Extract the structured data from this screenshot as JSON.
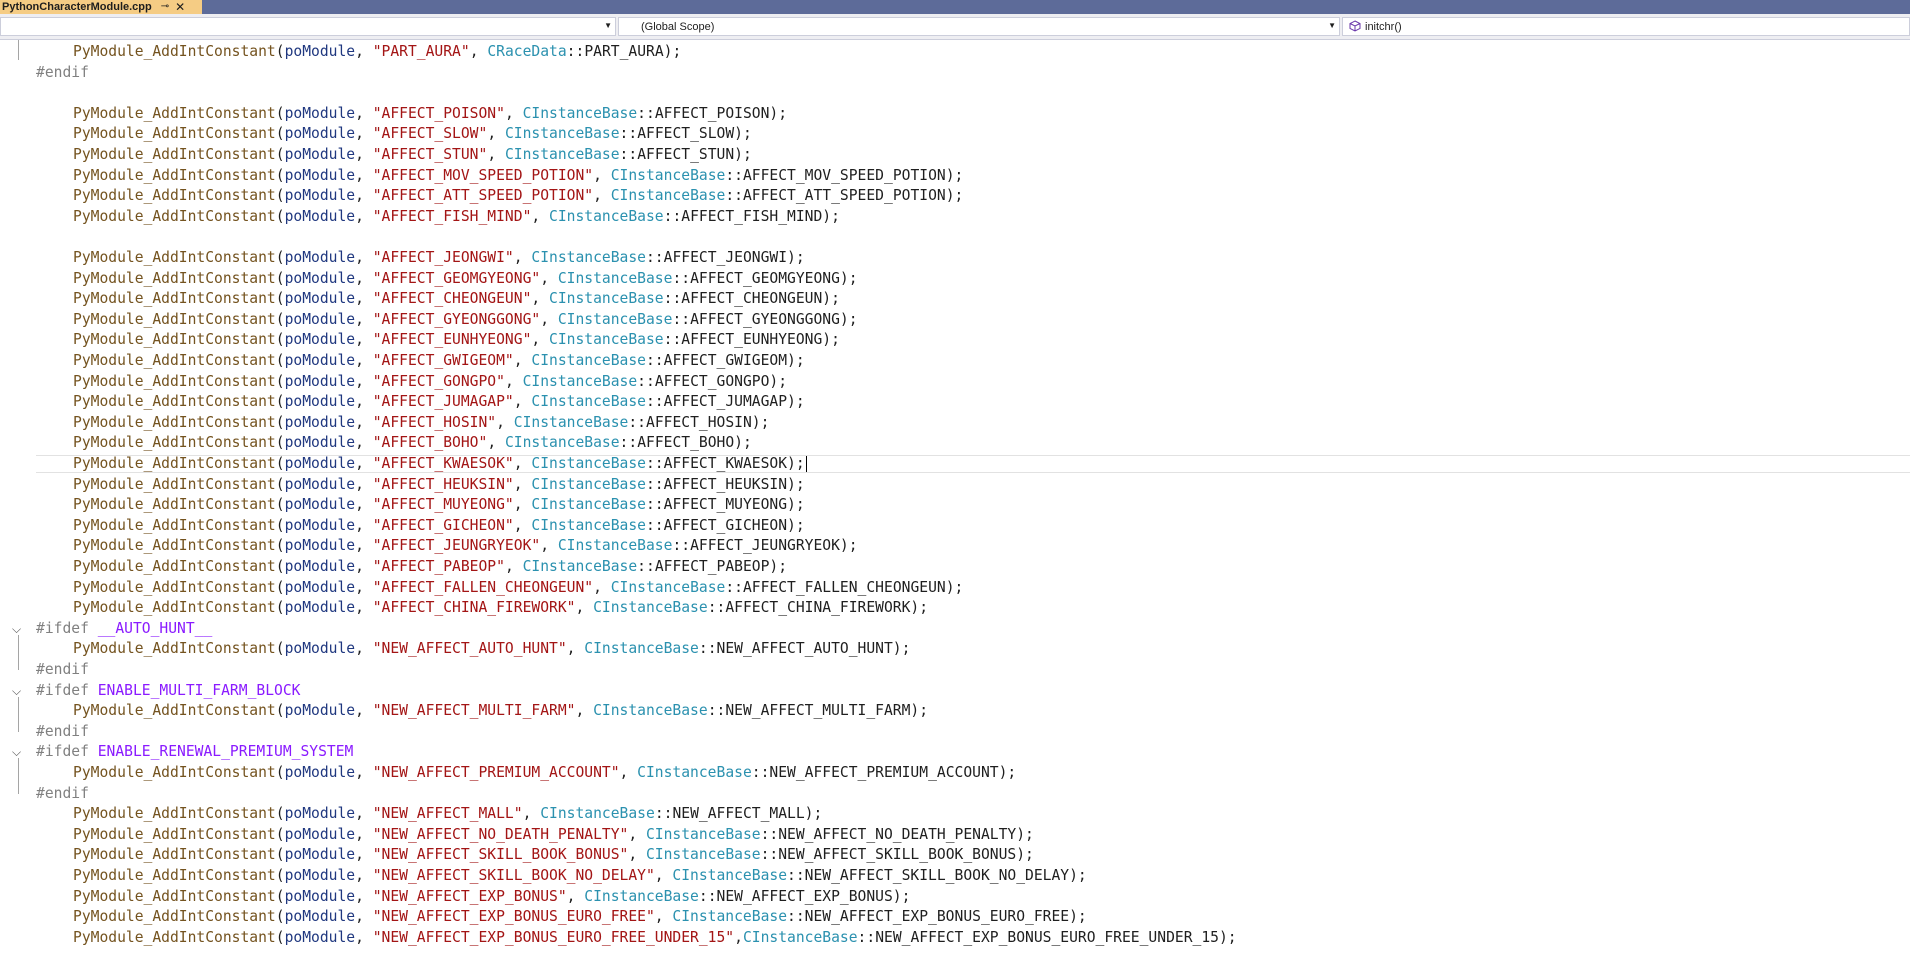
{
  "tab": {
    "title": "PythonCharacterModule.cpp",
    "pin_glyph": "⊸",
    "close_glyph": "✕"
  },
  "nav": {
    "project_combo": "",
    "scope_combo": "(Global Scope)",
    "member_combo": "initchr()"
  },
  "code": [
    {
      "kind": "call",
      "name": "PART_AURA",
      "cls": "CRaceData",
      "member": "PART_AURA"
    },
    {
      "kind": "pp",
      "directive": "#endif",
      "macro": ""
    },
    {
      "kind": "blank"
    },
    {
      "kind": "call",
      "name": "AFFECT_POISON",
      "cls": "CInstanceBase",
      "member": "AFFECT_POISON"
    },
    {
      "kind": "call",
      "name": "AFFECT_SLOW",
      "cls": "CInstanceBase",
      "member": "AFFECT_SLOW"
    },
    {
      "kind": "call",
      "name": "AFFECT_STUN",
      "cls": "CInstanceBase",
      "member": "AFFECT_STUN"
    },
    {
      "kind": "call",
      "name": "AFFECT_MOV_SPEED_POTION",
      "cls": "CInstanceBase",
      "member": "AFFECT_MOV_SPEED_POTION"
    },
    {
      "kind": "call",
      "name": "AFFECT_ATT_SPEED_POTION",
      "cls": "CInstanceBase",
      "member": "AFFECT_ATT_SPEED_POTION"
    },
    {
      "kind": "call",
      "name": "AFFECT_FISH_MIND",
      "cls": "CInstanceBase",
      "member": "AFFECT_FISH_MIND"
    },
    {
      "kind": "blank"
    },
    {
      "kind": "call",
      "name": "AFFECT_JEONGWI",
      "cls": "CInstanceBase",
      "member": "AFFECT_JEONGWI"
    },
    {
      "kind": "call",
      "name": "AFFECT_GEOMGYEONG",
      "cls": "CInstanceBase",
      "member": "AFFECT_GEOMGYEONG"
    },
    {
      "kind": "call",
      "name": "AFFECT_CHEONGEUN",
      "cls": "CInstanceBase",
      "member": "AFFECT_CHEONGEUN"
    },
    {
      "kind": "call",
      "name": "AFFECT_GYEONGGONG",
      "cls": "CInstanceBase",
      "member": "AFFECT_GYEONGGONG"
    },
    {
      "kind": "call",
      "name": "AFFECT_EUNHYEONG",
      "cls": "CInstanceBase",
      "member": "AFFECT_EUNHYEONG"
    },
    {
      "kind": "call",
      "name": "AFFECT_GWIGEOM",
      "cls": "CInstanceBase",
      "member": "AFFECT_GWIGEOM"
    },
    {
      "kind": "call",
      "name": "AFFECT_GONGPO",
      "cls": "CInstanceBase",
      "member": "AFFECT_GONGPO"
    },
    {
      "kind": "call",
      "name": "AFFECT_JUMAGAP",
      "cls": "CInstanceBase",
      "member": "AFFECT_JUMAGAP"
    },
    {
      "kind": "call",
      "name": "AFFECT_HOSIN",
      "cls": "CInstanceBase",
      "member": "AFFECT_HOSIN"
    },
    {
      "kind": "call",
      "name": "AFFECT_BOHO",
      "cls": "CInstanceBase",
      "member": "AFFECT_BOHO"
    },
    {
      "kind": "call",
      "name": "AFFECT_KWAESOK",
      "cls": "CInstanceBase",
      "member": "AFFECT_KWAESOK",
      "current": true
    },
    {
      "kind": "call",
      "name": "AFFECT_HEUKSIN",
      "cls": "CInstanceBase",
      "member": "AFFECT_HEUKSIN"
    },
    {
      "kind": "call",
      "name": "AFFECT_MUYEONG",
      "cls": "CInstanceBase",
      "member": "AFFECT_MUYEONG"
    },
    {
      "kind": "call",
      "name": "AFFECT_GICHEON",
      "cls": "CInstanceBase",
      "member": "AFFECT_GICHEON"
    },
    {
      "kind": "call",
      "name": "AFFECT_JEUNGRYEOK",
      "cls": "CInstanceBase",
      "member": "AFFECT_JEUNGRYEOK"
    },
    {
      "kind": "call",
      "name": "AFFECT_PABEOP",
      "cls": "CInstanceBase",
      "member": "AFFECT_PABEOP"
    },
    {
      "kind": "call",
      "name": "AFFECT_FALLEN_CHEONGEUN",
      "cls": "CInstanceBase",
      "member": "AFFECT_FALLEN_CHEONGEUN"
    },
    {
      "kind": "call",
      "name": "AFFECT_CHINA_FIREWORK",
      "cls": "CInstanceBase",
      "member": "AFFECT_CHINA_FIREWORK"
    },
    {
      "kind": "pp",
      "directive": "#ifdef",
      "macro": "__AUTO_HUNT__",
      "fold": true
    },
    {
      "kind": "call",
      "name": "NEW_AFFECT_AUTO_HUNT",
      "cls": "CInstanceBase",
      "member": "NEW_AFFECT_AUTO_HUNT"
    },
    {
      "kind": "pp",
      "directive": "#endif",
      "macro": ""
    },
    {
      "kind": "pp",
      "directive": "#ifdef",
      "macro": "ENABLE_MULTI_FARM_BLOCK",
      "fold": true
    },
    {
      "kind": "call",
      "name": "NEW_AFFECT_MULTI_FARM",
      "cls": "CInstanceBase",
      "member": "NEW_AFFECT_MULTI_FARM"
    },
    {
      "kind": "pp",
      "directive": "#endif",
      "macro": ""
    },
    {
      "kind": "pp",
      "directive": "#ifdef",
      "macro": "ENABLE_RENEWAL_PREMIUM_SYSTEM",
      "fold": true
    },
    {
      "kind": "call",
      "name": "NEW_AFFECT_PREMIUM_ACCOUNT",
      "cls": "CInstanceBase",
      "member": "NEW_AFFECT_PREMIUM_ACCOUNT"
    },
    {
      "kind": "pp",
      "directive": "#endif",
      "macro": ""
    },
    {
      "kind": "call",
      "name": "NEW_AFFECT_MALL",
      "cls": "CInstanceBase",
      "member": "NEW_AFFECT_MALL"
    },
    {
      "kind": "call",
      "name": "NEW_AFFECT_NO_DEATH_PENALTY",
      "cls": "CInstanceBase",
      "member": "NEW_AFFECT_NO_DEATH_PENALTY"
    },
    {
      "kind": "call",
      "name": "NEW_AFFECT_SKILL_BOOK_BONUS",
      "cls": "CInstanceBase",
      "member": "NEW_AFFECT_SKILL_BOOK_BONUS"
    },
    {
      "kind": "call",
      "name": "NEW_AFFECT_SKILL_BOOK_NO_DELAY",
      "cls": "CInstanceBase",
      "member": "NEW_AFFECT_SKILL_BOOK_NO_DELAY"
    },
    {
      "kind": "call",
      "name": "NEW_AFFECT_EXP_BONUS",
      "cls": "CInstanceBase",
      "member": "NEW_AFFECT_EXP_BONUS"
    },
    {
      "kind": "call",
      "name": "NEW_AFFECT_EXP_BONUS_EURO_FREE",
      "cls": "CInstanceBase",
      "member": "NEW_AFFECT_EXP_BONUS_EURO_FREE"
    },
    {
      "kind": "call",
      "name": "NEW_AFFECT_EXP_BONUS_EURO_FREE_UNDER_15",
      "cls": "CInstanceBase",
      "member": "NEW_AFFECT_EXP_BONUS_EURO_FREE_UNDER_15",
      "nospace": true
    }
  ],
  "tokens": {
    "func": "PyModule_AddIntConstant",
    "param": "poModule",
    "scope_op": "::"
  },
  "colors": {
    "tab_active": "#f5cc84",
    "tab_strip": "#5d6b99",
    "string": "#a31515",
    "class": "#2b91af",
    "function": "#74531f",
    "parameter": "#1f377f",
    "preprocessor": "#808080",
    "macro": "#8a1bff"
  }
}
